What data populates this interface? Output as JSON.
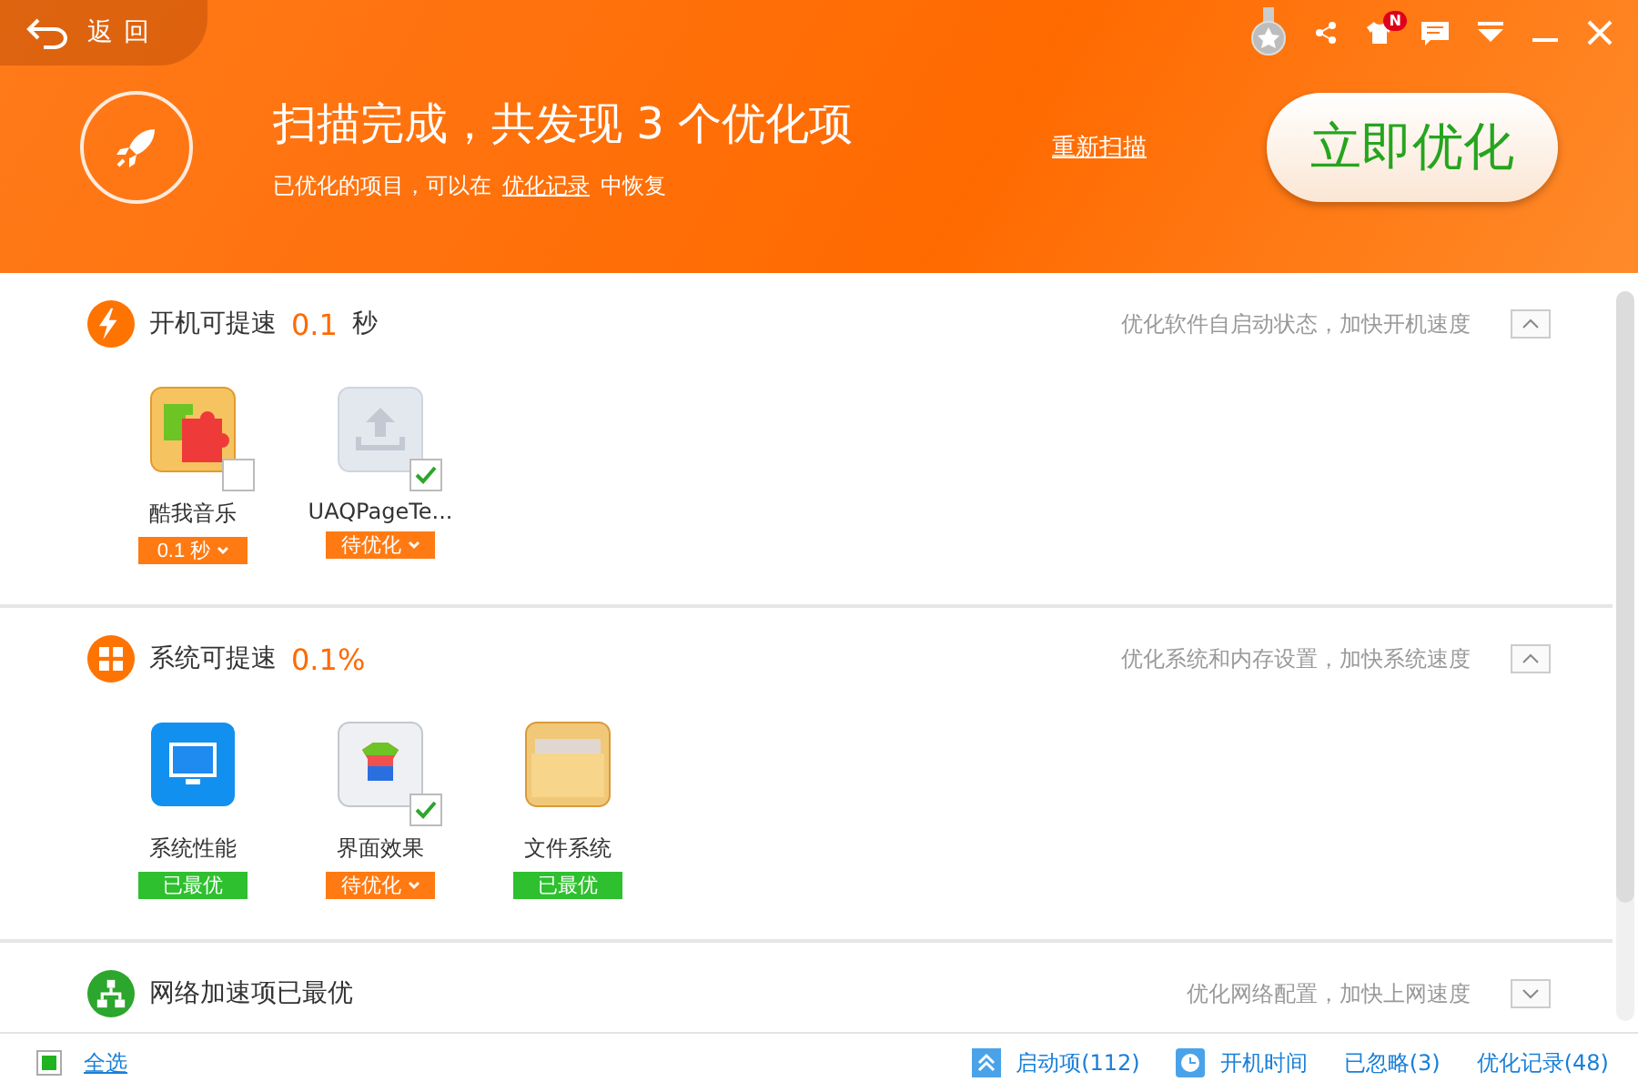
{
  "header": {
    "back_label": "返回",
    "badge": "N",
    "title": "扫描完成，共发现 3 个优化项",
    "subtitle_before": "已优化的项目，可以在",
    "subtitle_link": "优化记录",
    "subtitle_after": "中恢复",
    "rescan_link": "重新扫描",
    "optimize_button": "立即优化"
  },
  "sections": [
    {
      "label": "开机可提速",
      "value": "0.1",
      "unit": "秒",
      "description": "优化软件自启动状态，加快开机速度",
      "expanded": true,
      "items": [
        {
          "name": "酷我音乐",
          "checked": false,
          "tag": {
            "label": "0.1 秒",
            "kind": "pending"
          }
        },
        {
          "name": "UAQPageTe...",
          "checked": true,
          "tag": {
            "label": "待优化",
            "kind": "pending"
          }
        }
      ]
    },
    {
      "label": "系统可提速",
      "value": "0.1%",
      "description": "优化系统和内存设置，加快系统速度",
      "expanded": true,
      "items": [
        {
          "name": "系统性能",
          "tag": {
            "label": "已最优",
            "kind": "optimal"
          }
        },
        {
          "name": "界面效果",
          "checked": true,
          "tag": {
            "label": "待优化",
            "kind": "pending"
          }
        },
        {
          "name": "文件系统",
          "tag": {
            "label": "已最优",
            "kind": "optimal"
          }
        }
      ]
    },
    {
      "label": "网络加速项已最优",
      "description": "优化网络配置，加快上网速度",
      "expanded": false
    }
  ],
  "footer": {
    "select_all": {
      "label": "全选",
      "checked": true
    },
    "links": [
      "启动项(112)",
      "开机时间",
      "已忽略(3)",
      "优化记录(48)"
    ]
  }
}
